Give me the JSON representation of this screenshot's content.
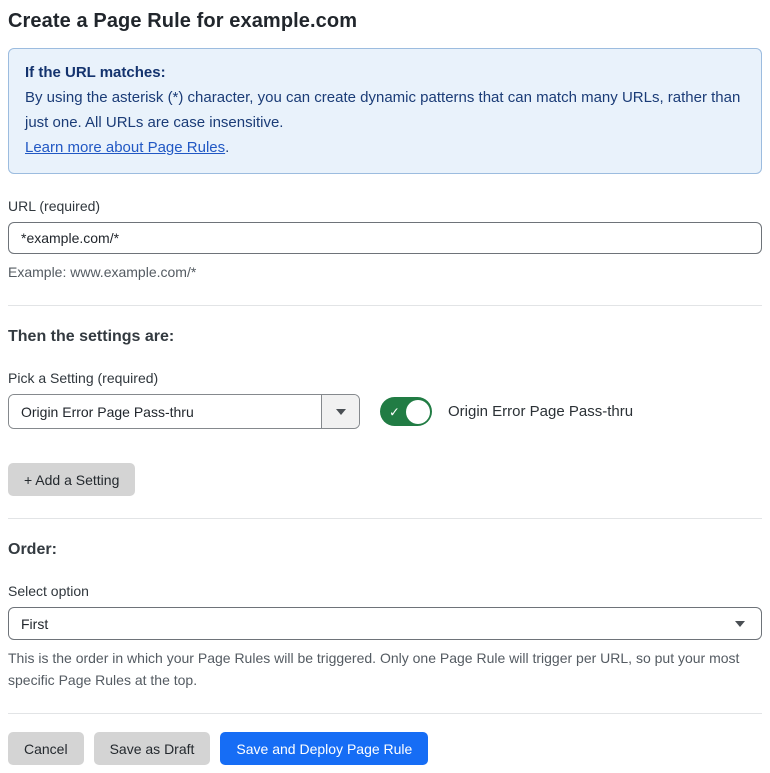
{
  "page": {
    "title": "Create a Page Rule for example.com"
  },
  "info_box": {
    "heading": "If the URL matches:",
    "body": "By using the asterisk (*) character, you can create dynamic patterns that can match many URLs, rather than just one. All URLs are case insensitive.",
    "link_label": "Learn more about Page Rules",
    "link_suffix": "."
  },
  "url_section": {
    "label": "URL (required)",
    "input_value": "*example.com/*",
    "helper": "Example: www.example.com/*"
  },
  "settings_section": {
    "heading": "Then the settings are:",
    "picker_label": "Pick a Setting (required)",
    "picker_value": "Origin Error Page Pass-thru",
    "toggle_state": "on",
    "toggle_check_glyph": "✓",
    "toggle_label": "Origin Error Page Pass-thru",
    "add_setting_label": "+ Add a Setting"
  },
  "order_section": {
    "heading": "Order:",
    "select_label": "Select option",
    "select_value": "First",
    "helper": "This is the order in which your Page Rules will be triggered. Only one Page Rule will trigger per URL, so put your most specific Page Rules at the top."
  },
  "footer": {
    "cancel_label": "Cancel",
    "save_draft_label": "Save as Draft",
    "save_deploy_label": "Save and Deploy Page Rule"
  },
  "colors": {
    "accent_blue": "#166df5",
    "info_bg": "#e9f2fb",
    "info_border": "#9cbcdf",
    "info_text": "#1b3c77",
    "link_blue": "#2158c4",
    "toggle_green": "#217c44",
    "button_gray": "#d4d4d4"
  }
}
